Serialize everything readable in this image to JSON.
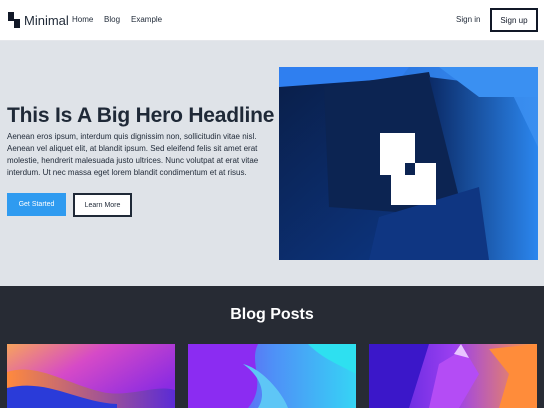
{
  "header": {
    "brand": "Minimal",
    "nav": [
      "Home",
      "Blog",
      "Example"
    ],
    "signin": "Sign in",
    "signup": "Sign up"
  },
  "hero": {
    "title": "This Is A Big Hero Headline",
    "text": "Aenean eros ipsum, interdum quis dignissim non, sollicitudin vitae nisl. Aenean vel aliquet elit, at blandit ipsum. Sed eleifend felis sit amet erat molestie, hendrerit malesuada justo ultrices. Nunc volutpat at erat vitae interdum. Ut nec massa eget lorem blandit condimentum et at risus.",
    "primary_button": "Get Started",
    "secondary_button": "Learn More"
  },
  "blog": {
    "title": "Blog Posts"
  },
  "colors": {
    "accent": "#2f9bf0",
    "hero_bg": "#dfe3e8",
    "blog_bg": "#272b34"
  }
}
